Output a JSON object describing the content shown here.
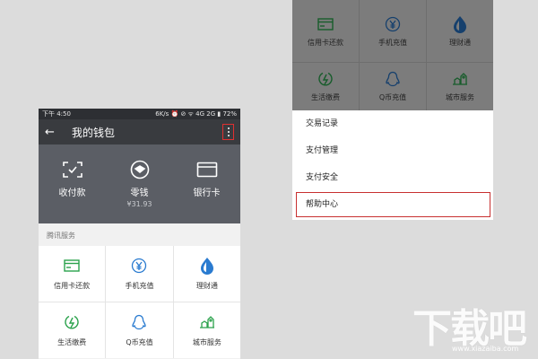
{
  "left": {
    "status": {
      "time": "下午 4:50",
      "right": "6K/s ⏰ ⊘ ᯤ 4G 2G ▮ 72%"
    },
    "nav": {
      "back": "←",
      "title": "我的钱包"
    },
    "wallet": [
      {
        "label": "收付款",
        "sub": ""
      },
      {
        "label": "零钱",
        "sub": "¥31.93"
      },
      {
        "label": "银行卡",
        "sub": ""
      }
    ],
    "section": "腾讯服务",
    "services": [
      {
        "label": "信用卡还款",
        "icon": "credit-card-icon"
      },
      {
        "label": "手机充值",
        "icon": "yen-coin-icon"
      },
      {
        "label": "理财通",
        "icon": "water-drop-icon"
      },
      {
        "label": "生活缴费",
        "icon": "lightning-icon"
      },
      {
        "label": "Q币充值",
        "icon": "penguin-icon"
      },
      {
        "label": "城市服务",
        "icon": "city-icon"
      }
    ]
  },
  "right": {
    "services": [
      {
        "label": "信用卡还款"
      },
      {
        "label": "手机充值"
      },
      {
        "label": "理财通"
      },
      {
        "label": "生活缴费"
      },
      {
        "label": "Q币充值"
      },
      {
        "label": "城市服务"
      }
    ],
    "menu": [
      "交易记录",
      "支付管理",
      "支付安全",
      "帮助中心"
    ]
  },
  "watermark": {
    "text": "下载吧",
    "url": "www.xiazaiba.com"
  },
  "colors": {
    "green": "#2ba24c",
    "highlight": "#c83030",
    "navbar": "#393b3f",
    "wallet": "#5b5e65"
  }
}
